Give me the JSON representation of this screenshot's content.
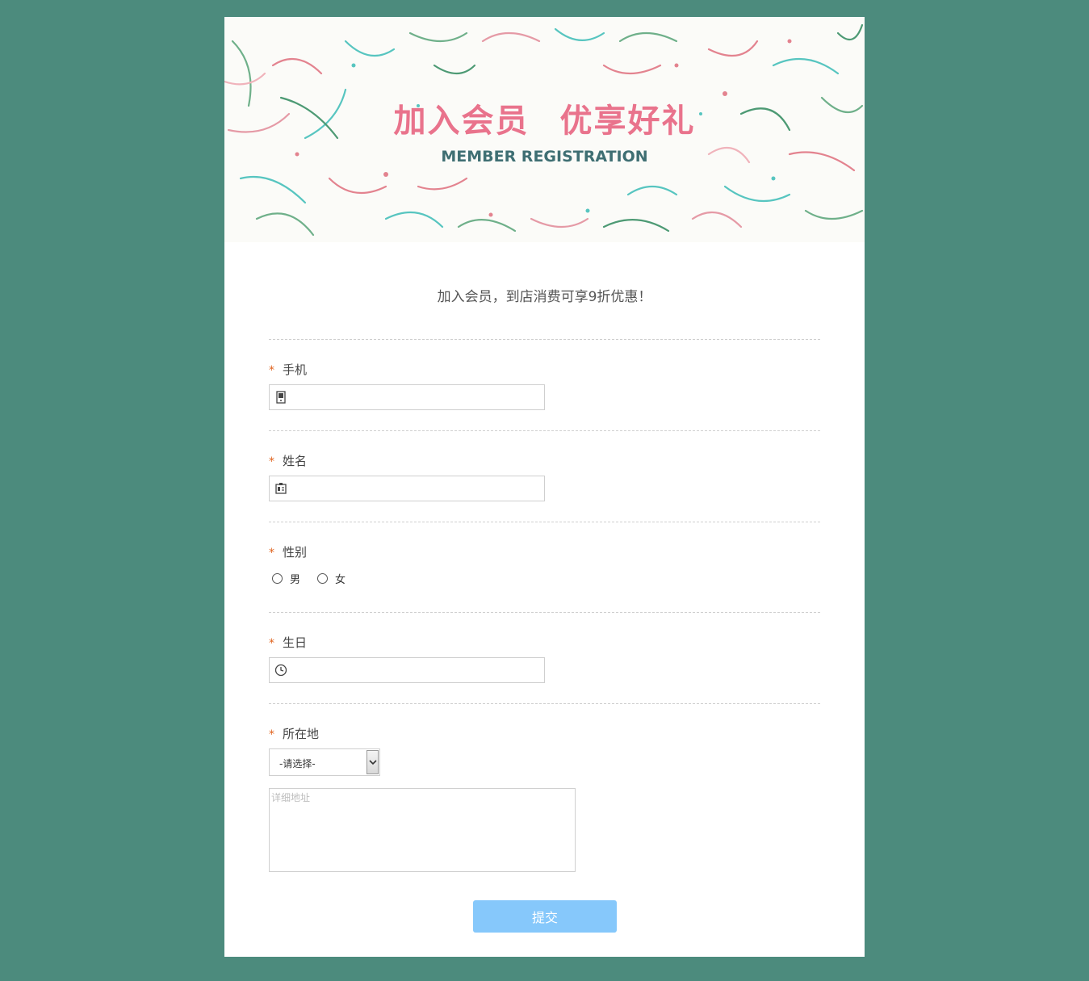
{
  "banner": {
    "title": "加入会员  优享好礼",
    "subtitle": "MEMBER REGISTRATION"
  },
  "intro": "加入会员，到店消费可享9折优惠！",
  "fields": {
    "phone": {
      "label": "手机",
      "required_mark": "*",
      "icon": "phone-icon",
      "value": ""
    },
    "name": {
      "label": "姓名",
      "required_mark": "*",
      "icon": "id-card-icon",
      "value": ""
    },
    "gender": {
      "label": "性别",
      "required_mark": "*",
      "options": [
        "男",
        "女"
      ]
    },
    "birthday": {
      "label": "生日",
      "required_mark": "*",
      "icon": "clock-icon",
      "value": ""
    },
    "location": {
      "label": "所在地",
      "required_mark": "*",
      "select_value": "-请选择-",
      "address_placeholder": "详细地址"
    }
  },
  "submit_label": "提交",
  "colors": {
    "page_background": "#4c8b7d",
    "title_pink": "#e9738c",
    "subtitle_teal": "#3f6f73",
    "required_orange": "#e0631f",
    "submit_blue": "#86c8fb"
  }
}
